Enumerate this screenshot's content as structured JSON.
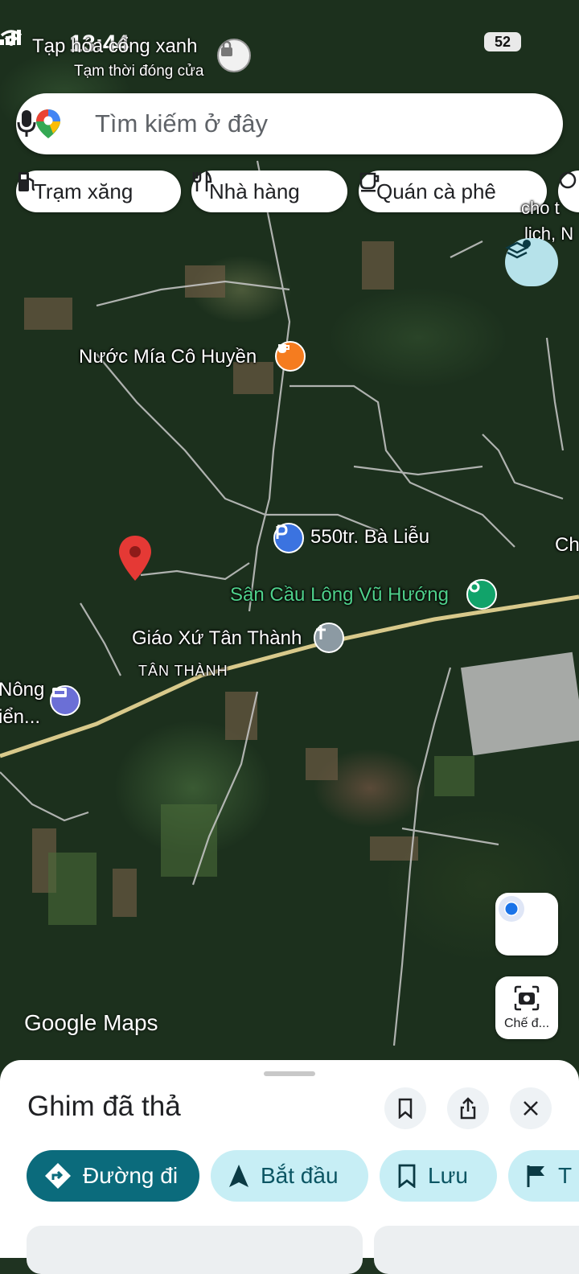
{
  "status_bar": {
    "time": "13:44",
    "battery": "52"
  },
  "top_poi": {
    "name": "Tạp hóa cổng xanh",
    "status": "Tạm thời đóng cửa"
  },
  "search": {
    "placeholder": "Tìm kiếm ở đây"
  },
  "chips": [
    {
      "label": "Trạm xăng",
      "icon": "gas-station-icon"
    },
    {
      "label": "Nhà hàng",
      "icon": "restaurant-icon"
    },
    {
      "label": "Quán cà phê",
      "icon": "coffee-icon"
    }
  ],
  "map_labels": {
    "edge_top_right_1": "cho t",
    "edge_top_right_2": "lịch, N",
    "nuoc_mia": "Nước Mía Cô Huyền",
    "ba_lieu": "550tr. Bà Liễu",
    "edge_right": "Ch",
    "san_cau_long": "Sân Cầu Lông Vũ Hướng",
    "giao_xu": "Giáo Xứ Tân Thành",
    "tan_thanh": "TÂN THÀNH",
    "edge_left_1": "Nông",
    "edge_left_2": "iển..."
  },
  "map_controls": {
    "lens_label": "Chế đ...",
    "watermark": "Google Maps"
  },
  "bottom_sheet": {
    "title": "Ghim đã thả",
    "actions": [
      {
        "label": "Đường đi",
        "icon": "directions-icon"
      },
      {
        "label": "Bắt đầu",
        "icon": "navigation-arrow-icon"
      },
      {
        "label": "Lưu",
        "icon": "bookmark-icon"
      },
      {
        "label": "T",
        "icon": "flag-icon"
      }
    ]
  },
  "colors": {
    "primary": "#0b6b7c",
    "secondary": "#c7eef5",
    "pin": "#e53935",
    "green_label": "#4fd18b"
  }
}
